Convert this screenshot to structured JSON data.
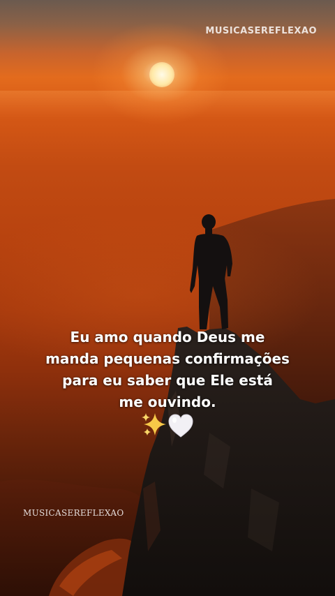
{
  "watermark_top": "MUSICASEREFLEXAO",
  "watermark_bottom": "MUSICASEREFLEXAO",
  "quote": {
    "lines": [
      "Eu amo quando Deus me",
      "manda pequenas confirmações",
      "para eu saber que Ele está",
      "me ouvindo."
    ]
  },
  "emojis": [
    "sparkles-icon",
    "white-heart-icon"
  ],
  "colors": {
    "sky_top": "#6b5a4f",
    "sun_glow": "#e36b1d",
    "mist": "#b8430f",
    "rock": "#1c1715",
    "text": "#ffffff"
  }
}
